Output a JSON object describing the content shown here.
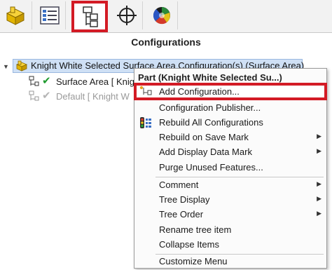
{
  "toolbar": {
    "tabs": [
      {
        "name": "feature-manager-tab-icon"
      },
      {
        "name": "property-manager-tab-icon"
      },
      {
        "name": "configuration-manager-tab-icon",
        "active": true
      },
      {
        "name": "dimxpert-manager-tab-icon"
      },
      {
        "name": "display-manager-tab-icon"
      }
    ],
    "highlight_color": "#d31b25"
  },
  "panel": {
    "title": "Configurations"
  },
  "tree": {
    "root_label": "Knight White Selected Surface Area Configuration(s)  (Surface Area)",
    "items": [
      {
        "label": "Surface Area [ Knight"
      },
      {
        "label": "Default [ Knight W"
      }
    ]
  },
  "context_menu": {
    "header": "Part (Knight White Selected Su...)",
    "items": {
      "add_configuration": "Add Configuration...",
      "configuration_publisher": "Configuration Publisher...",
      "rebuild_all": "Rebuild All Configurations",
      "rebuild_on_save": "Rebuild on Save Mark",
      "add_display_data": "Add Display Data Mark",
      "purge_unused": "Purge Unused Features...",
      "comment": "Comment",
      "tree_display": "Tree Display",
      "tree_order": "Tree Order",
      "rename_tree_item": "Rename tree item",
      "collapse_items": "Collapse Items",
      "customize_menu": "Customize Menu"
    }
  }
}
